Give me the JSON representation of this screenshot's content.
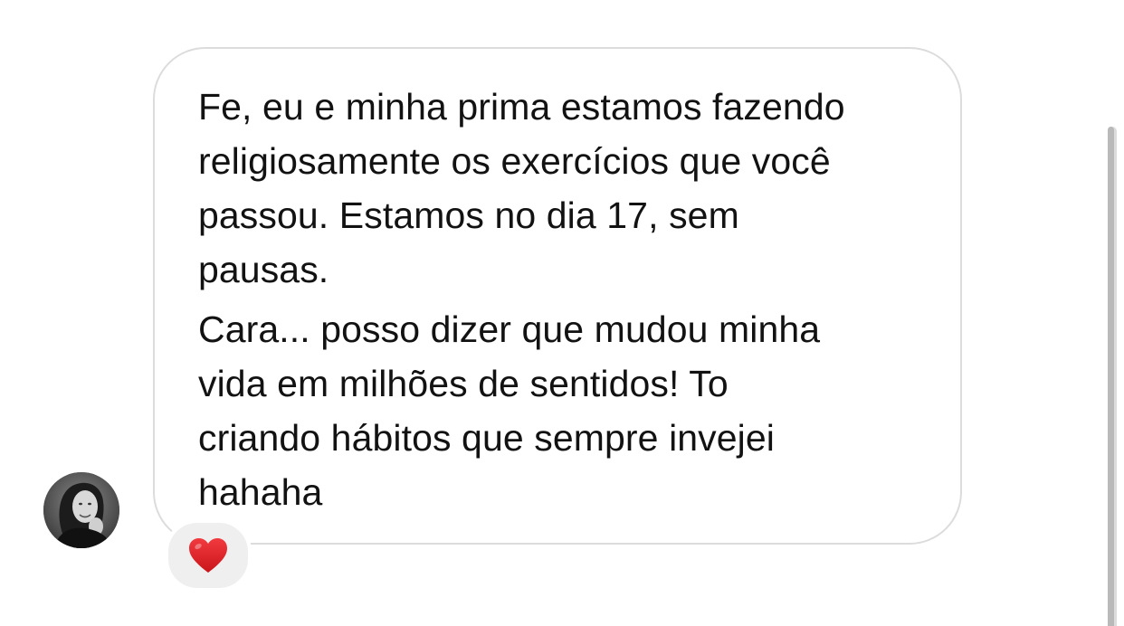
{
  "message": {
    "paragraphs": [
      "Fe, eu e minha prima estamos fazendo\nreligiosamente os exercícios que você\npassou. Estamos no dia 17, sem\npausas.",
      "Cara... posso dizer que mudou minha\nvida em milhões de sentidos! To\ncriando hábitos que sempre invejei\nhahaha"
    ]
  },
  "reaction": {
    "icon": "red-heart-icon",
    "color": "#e0242d"
  },
  "avatar": {
    "icon": "profile-photo"
  },
  "colors": {
    "bubble_border": "#dcdcdc",
    "reaction_bg": "#efefef",
    "text": "#121212"
  }
}
